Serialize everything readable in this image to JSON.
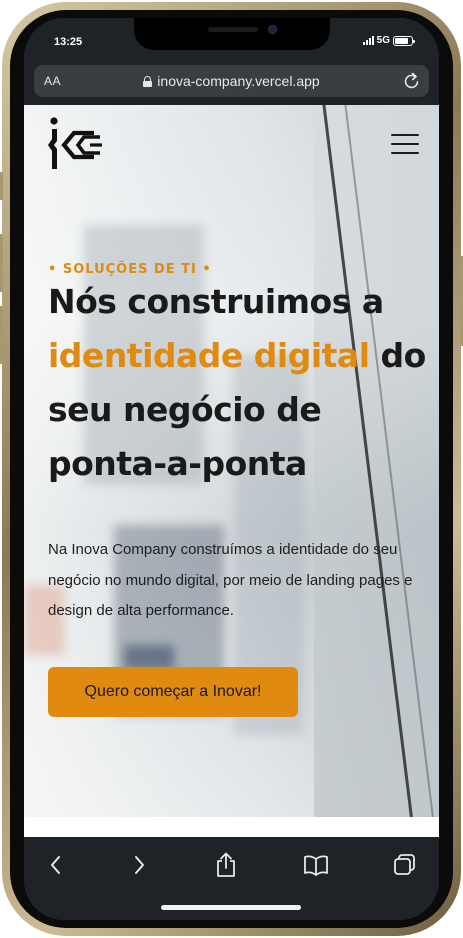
{
  "status_bar": {
    "time": "13:25",
    "network": "5G"
  },
  "browser": {
    "text_size_label": "AA",
    "url": "inova-company.vercel.app"
  },
  "page": {
    "eyebrow": "• SOLUÇÕES DE TI •",
    "headline": {
      "part1": "Nós construimos a",
      "accent": "identidade digital",
      "part2": "do seu negócio de ponta-a-ponta"
    },
    "lead": "Na Inova Company construímos a identidade do seu negócio no mundo digital, por meio de landing pages e design de alta performance.",
    "cta_label": "Quero começar a Inovar!"
  },
  "colors": {
    "accent": "#e08a0f",
    "browser_chrome": "#1f2327",
    "url_bar": "#3a3d41"
  },
  "icons": {
    "brand": "inova-company-logo-icon",
    "menu": "hamburger-menu-icon",
    "toolbar": [
      "back-arrow-icon",
      "forward-arrow-icon",
      "share-icon",
      "bookmarks-book-icon",
      "tabs-icon"
    ]
  }
}
